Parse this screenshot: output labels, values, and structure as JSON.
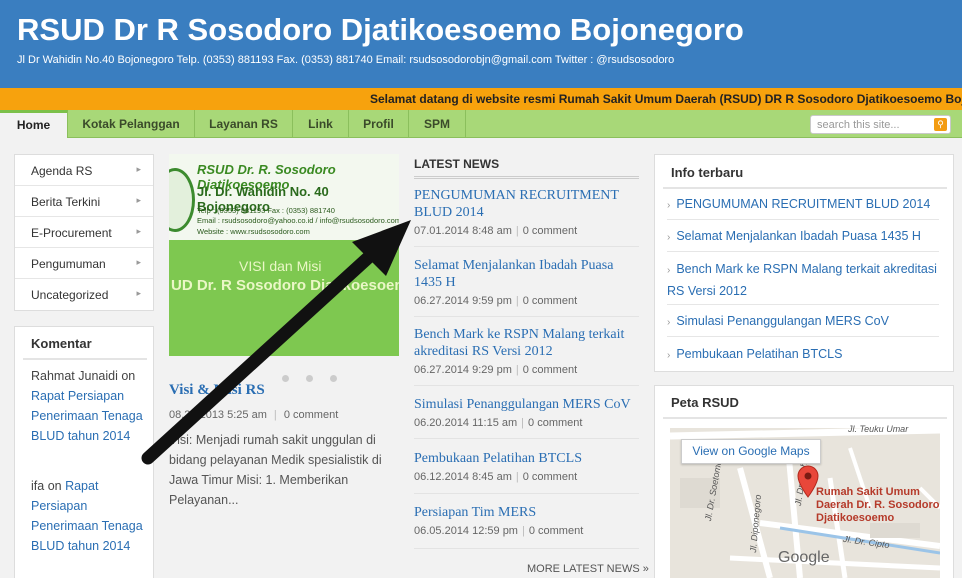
{
  "header": {
    "title": "RSUD Dr R Sosodoro Djatikoesoemo Bojonegoro",
    "description": "Jl Dr Wahidin No.40 Bojonegoro Telp. (0353) 881193 Fax. (0353) 881740 Email: rsudsosodorobjn@gmail.com Twitter : @rsudsosodoro"
  },
  "ticker": "Selamat datang di website resmi Rumah Sakit Umum Daerah (RSUD) DR R Sosodoro Djatikoesoemo Bojo",
  "nav": {
    "items": [
      "Home",
      "Kotak Pelanggan",
      "Layanan RS",
      "Link",
      "Profil",
      "SPM"
    ],
    "active": "Home"
  },
  "search": {
    "placeholder": "search this site..."
  },
  "leftmenu": {
    "items": [
      "Agenda RS",
      "Berita Terkini",
      "E-Procurement",
      "Pengumuman",
      "Uncategorized"
    ]
  },
  "komentar": {
    "title": "Komentar",
    "entries": [
      {
        "author": "Rahmat Junaidi",
        "on": "on",
        "post": "Rapat Persiapan Penerimaan Tenaga BLUD tahun 2014"
      },
      {
        "author": "ifa",
        "on": "on",
        "post": "Rapat Persiapan Penerimaan Tenaga BLUD tahun 2014"
      }
    ]
  },
  "slider": {
    "banner_title": "RSUD Dr. R. Sosodoro Djatikoesoemo",
    "banner_address": "Jl. Dr. Wahidin No. 40 Bojonegoro",
    "banner_contact": "Telp : (0353) 881193 Fax : (0353) 881740",
    "banner_email": "Email : rsudsosodoro@yahoo.co.id / info@rsudsosodoro.com",
    "banner_website": "Website : www.rsudsosodoro.com",
    "banner_visi": "VISI dan Misi",
    "banner_big": "UD Dr. R Sosodoro Djatikoesoemo"
  },
  "post": {
    "title": "Visi & Misi RS",
    "date": "08.22.2013 5:25 am",
    "comments": "0 comment",
    "excerpt": "Visi: Menjadi rumah sakit unggulan di bidang pelayanan Medik spesialistik di Jawa Timur Misi: 1. Memberikan Pelayanan..."
  },
  "latest_news": {
    "heading": "LATEST NEWS",
    "items": [
      {
        "title": "PENGUMUMAN RECRUITMENT BLUD 2014",
        "date": "07.01.2014 8:48 am",
        "comments": "0 comment"
      },
      {
        "title": "Selamat Menjalankan Ibadah Puasa 1435 H",
        "date": "06.27.2014 9:59 pm",
        "comments": "0 comment"
      },
      {
        "title": "Bench Mark ke RSPN Malang terkait akreditasi RS Versi 2012",
        "date": "06.27.2014 9:29 pm",
        "comments": "0 comment"
      },
      {
        "title": "Simulasi Penanggulangan MERS CoV",
        "date": "06.20.2014 11:15 am",
        "comments": "0 comment"
      },
      {
        "title": "Pembukaan Pelatihan BTCLS",
        "date": "06.12.2014 8:45 am",
        "comments": "0 comment"
      },
      {
        "title": "Persiapan Tim MERS",
        "date": "06.05.2014 12:59 pm",
        "comments": "0 comment"
      }
    ],
    "more": "MORE LATEST NEWS »"
  },
  "info_terbaru": {
    "title": "Info terbaru",
    "items": [
      "PENGUMUMAN RECRUITMENT BLUD 2014",
      "Selamat Menjalankan Ibadah Puasa 1435 H",
      "Bench Mark ke RSPN Malang terkait akreditasi RS Versi 2012",
      "Simulasi Penanggulangan MERS CoV",
      "Pembukaan Pelatihan BTCLS"
    ]
  },
  "peta": {
    "title": "Peta RSUD",
    "view_button": "View on Google Maps",
    "marker_label": "Rumah Sakit Umum Daerah Dr. R. Sosodoro Djatikoesoemo",
    "streets": [
      "Jl. Teuku Umar",
      "Jl. Dr. Soetomo",
      "Jl. Dr. Wahidin",
      "Jl. Diponegoro",
      "Jl. Dr. Cipto"
    ],
    "logo": "Google"
  },
  "colors": {
    "header_bg": "#3a7ec0",
    "ticker_bg": "#f7a20d",
    "nav_bg": "#a8d878",
    "link": "#2a6eb3"
  }
}
